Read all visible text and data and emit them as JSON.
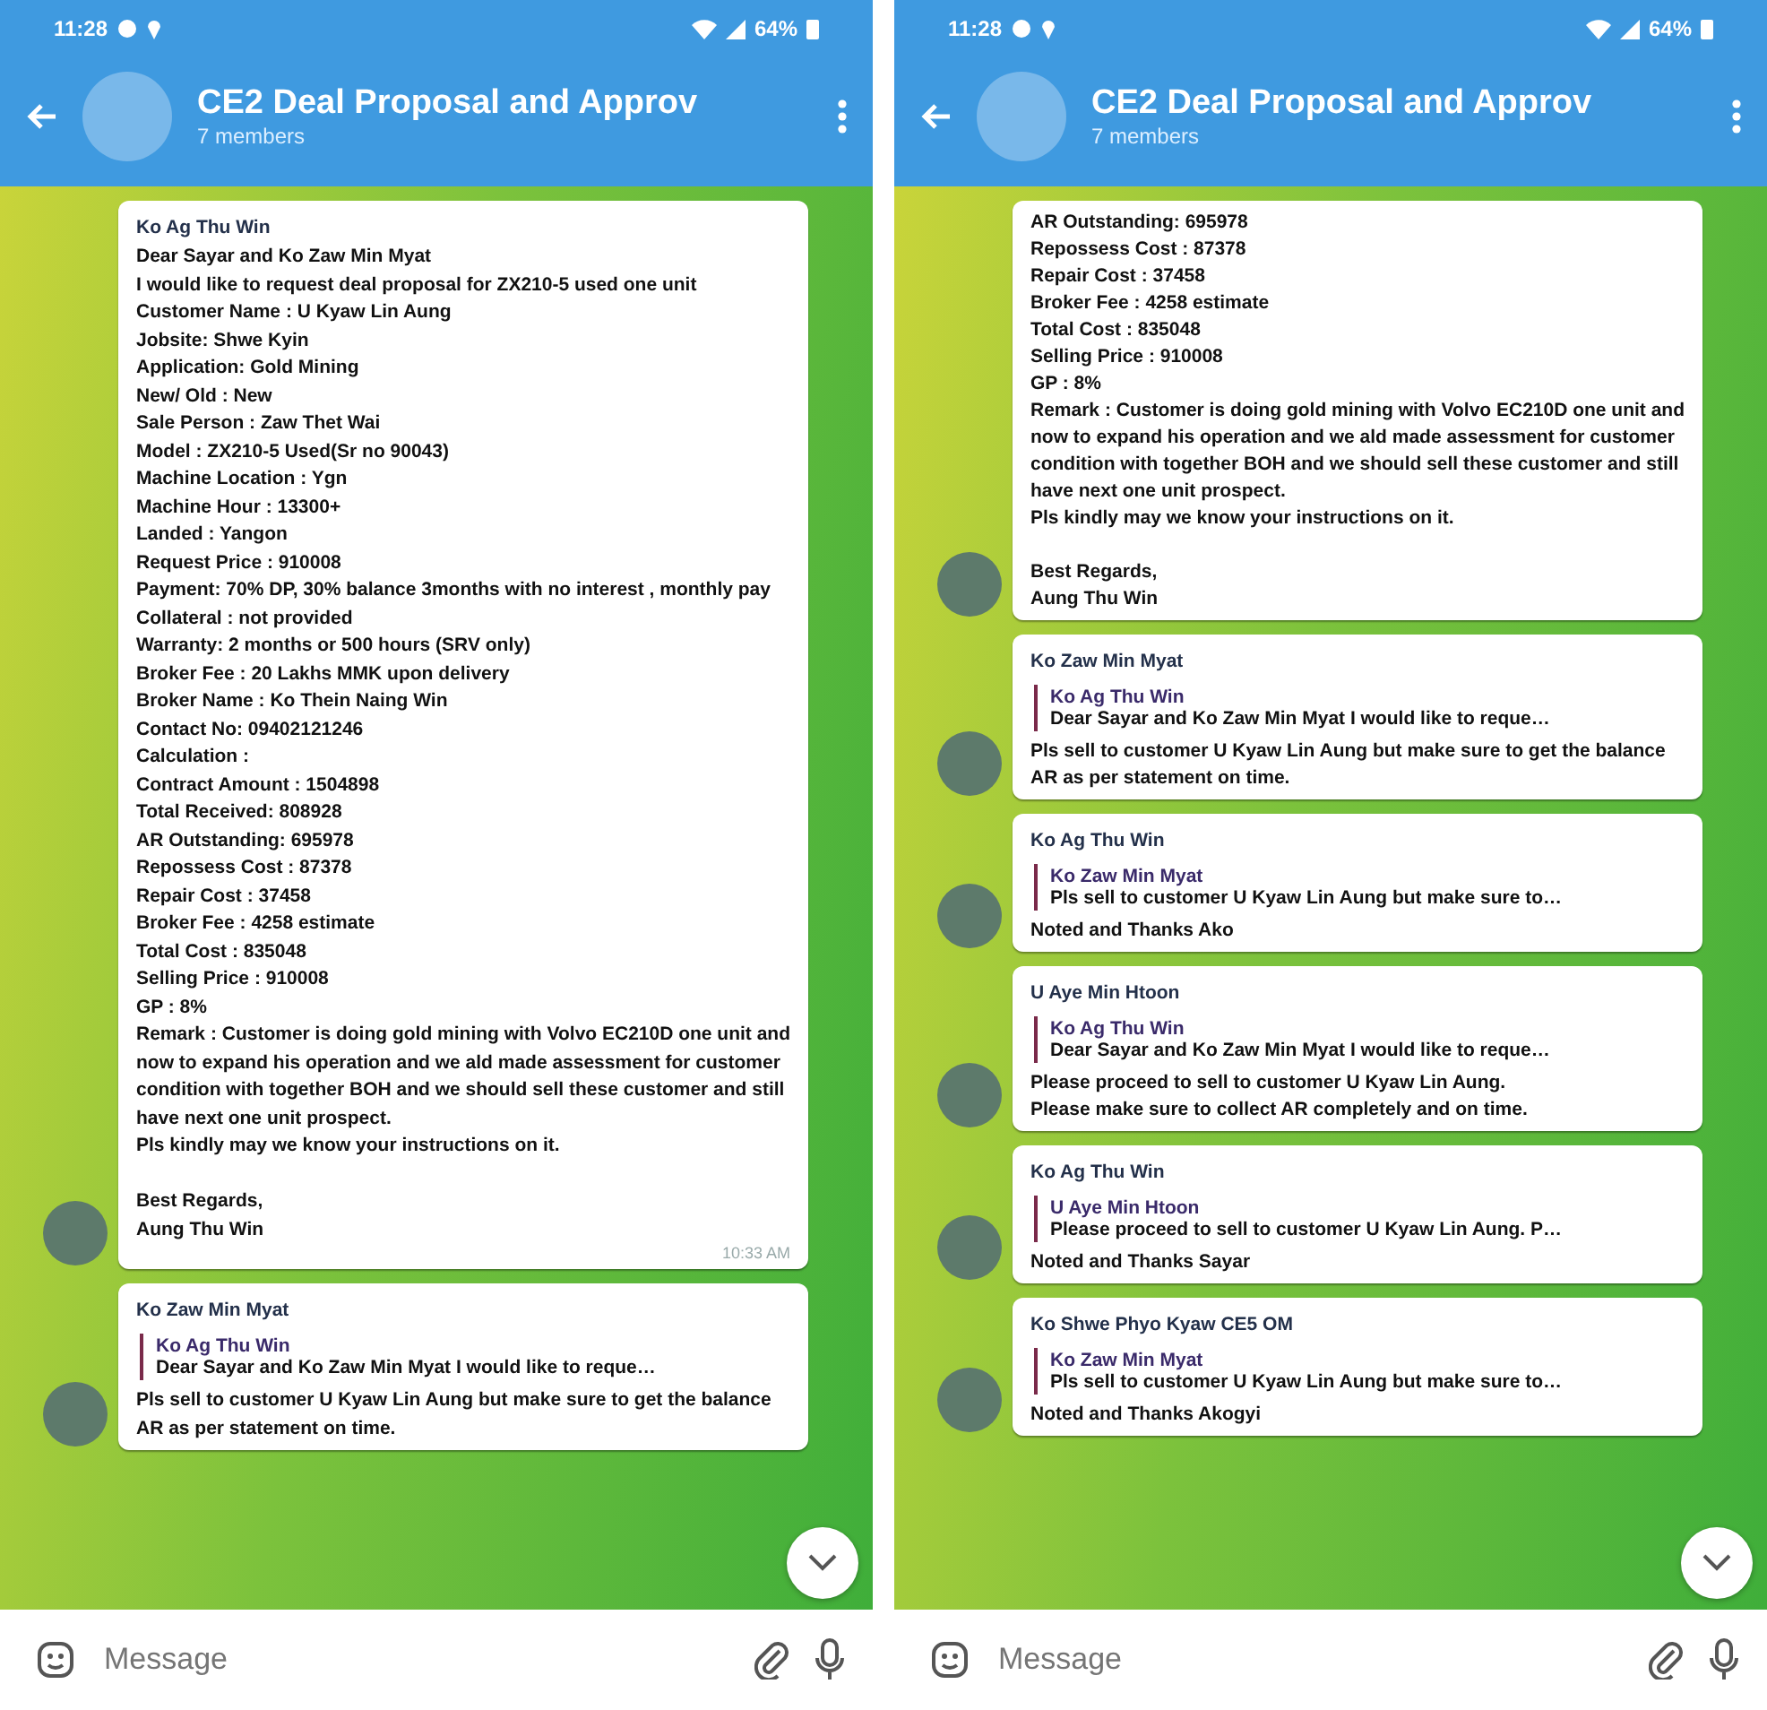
{
  "screens": [
    {
      "status_bar": {
        "time": "11:28",
        "battery": "64%"
      },
      "header": {
        "title": "CE2 Deal Proposal and Approv",
        "subtitle": "7 members"
      },
      "messages": [
        {
          "sender": "Ko Ag Thu Win",
          "text": "Dear Sayar and Ko Zaw Min Myat\nI would like to request deal proposal for ZX210-5 used one unit\nCustomer Name : U Kyaw Lin Aung\nJobsite: Shwe Kyin\nApplication: Gold Mining\nNew/ Old : New\nSale Person : Zaw Thet Wai\nModel : ZX210-5 Used(Sr no 90043)\nMachine Location : Ygn\nMachine Hour : 13300+\nLanded : Yangon\nRequest Price : 910008\nPayment: 70% DP, 30% balance 3months with no interest , monthly pay\nCollateral : not provided\nWarranty: 2 months or 500 hours (SRV only)\nBroker Fee : 20 Lakhs MMK upon delivery\nBroker Name : Ko Thein Naing Win\nContact No: 09402121246\nCalculation :\nContract Amount : 1504898\nTotal Received: 808928\nAR Outstanding: 695978\nRepossess Cost : 87378\nRepair Cost : 37458\nBroker Fee : 4258 estimate\nTotal Cost : 835048\nSelling Price : 910008\nGP : 8%\nRemark : Customer is doing gold mining with Volvo EC210D one unit and now to expand his operation and we ald made assessment for customer condition with together BOH and we should sell these customer and still have next one unit prospect.\nPls kindly may we know your instructions on it.\n\nBest Regards,\nAung Thu Win",
          "time": "10:33 AM",
          "avatar": true
        },
        {
          "sender": "Ko Zaw Min Myat",
          "reply": {
            "sender": "Ko Ag Thu Win",
            "text": "Dear Sayar and Ko Zaw Min Myat  I would like to reque…"
          },
          "text": "Pls sell to customer U Kyaw Lin Aung but make sure to get the balance AR as per statement on time.",
          "avatar": true
        }
      ],
      "input": {
        "placeholder": "Message"
      }
    },
    {
      "status_bar": {
        "time": "11:28",
        "battery": "64%"
      },
      "header": {
        "title": "CE2 Deal Proposal and Approv",
        "subtitle": "7 members"
      },
      "messages": [
        {
          "text": "AR Outstanding: 695978\nRepossess Cost : 87378\nRepair Cost : 37458\nBroker Fee : 4258 estimate\nTotal Cost : 835048\nSelling Price : 910008\nGP : 8%\nRemark : Customer is doing gold mining with Volvo EC210D one unit and now to expand his operation and we ald made assessment for customer condition with together BOH and we should sell these customer and still have next one unit prospect.\nPls kindly may we know your instructions on it.\n\nBest Regards,\nAung Thu Win",
          "avatar": true
        },
        {
          "sender": "Ko Zaw Min Myat",
          "reply": {
            "sender": "Ko Ag Thu Win",
            "text": "Dear Sayar and Ko Zaw Min Myat  I would like to reque…"
          },
          "text": "Pls sell to customer U Kyaw Lin Aung but make sure to get the balance AR as per statement on time.",
          "avatar": true
        },
        {
          "sender": "Ko Ag Thu Win",
          "reply": {
            "sender": "Ko Zaw Min Myat",
            "text": "Pls sell to customer U Kyaw Lin Aung but make sure to…"
          },
          "text": "Noted and Thanks Ako",
          "avatar": true
        },
        {
          "sender": "U Aye Min Htoon",
          "reply": {
            "sender": "Ko Ag Thu Win",
            "text": "Dear Sayar and Ko Zaw Min Myat  I would like to reque…"
          },
          "text": "Please proceed to sell to customer U Kyaw Lin Aung.\nPlease make sure to collect AR completely and on time.",
          "avatar": true
        },
        {
          "sender": "Ko Ag Thu Win",
          "reply": {
            "sender": "U Aye Min Htoon",
            "text": "Please proceed to sell to customer U Kyaw Lin Aung. P…"
          },
          "text": "Noted and Thanks Sayar",
          "avatar": true
        },
        {
          "sender": "Ko Shwe Phyo Kyaw CE5 OM",
          "reply": {
            "sender": "Ko Zaw Min Myat",
            "text": "Pls sell to customer U Kyaw Lin Aung but make sure to…"
          },
          "text": "Noted and Thanks Akogyi",
          "avatar": true
        }
      ],
      "input": {
        "placeholder": "Message"
      }
    }
  ]
}
